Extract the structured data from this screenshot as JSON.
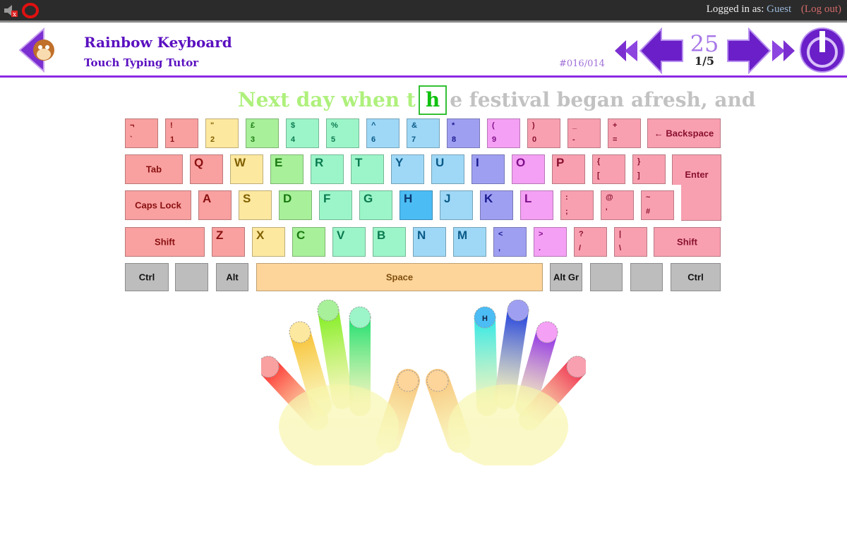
{
  "topbar": {
    "logged_in_label": "Logged in as:",
    "user": "Guest",
    "logout": "(Log out)",
    "icons": [
      "speaker-muted-icon",
      "lips-icon"
    ]
  },
  "header": {
    "title": "Rainbow Keyboard",
    "subtitle": "Touch Typing Tutor",
    "exercise_code": "#016/014",
    "lesson_number": "25",
    "page": "1/5",
    "icons": [
      "back-mascot-icon",
      "first-icon",
      "prev-icon",
      "next-icon",
      "last-icon",
      "power-icon"
    ]
  },
  "sentence": {
    "typed": "Next day when t",
    "current": "h",
    "remaining": "e festival began afresh, and"
  },
  "colors": {
    "pinkyL": "#f9a0a0",
    "ringL": "#fde8a0",
    "middleL": "#a8f09a",
    "indexL": "#9cf5c8",
    "indexR": "#9ed8f6",
    "active": "#4cbcf4",
    "middleR": "#9f9ff2",
    "ringR": "#f4a0f4",
    "pinkyR": "#f8a0b0",
    "thumb": "#fdd49a",
    "mod": "#bdbdbd"
  },
  "keyboard": {
    "rows": [
      [
        {
          "up": "¬",
          "lo": "`",
          "f": "pinkyL"
        },
        {
          "up": "!",
          "lo": "1",
          "f": "pinkyL"
        },
        {
          "up": "\"",
          "lo": "2",
          "f": "ringL"
        },
        {
          "up": "£",
          "lo": "3",
          "f": "middleL"
        },
        {
          "up": "$",
          "lo": "4",
          "f": "indexL"
        },
        {
          "up": "%",
          "lo": "5",
          "f": "indexL"
        },
        {
          "up": "^",
          "lo": "6",
          "f": "indexR"
        },
        {
          "up": "&",
          "lo": "7",
          "f": "indexR"
        },
        {
          "up": "*",
          "lo": "8",
          "f": "middleR"
        },
        {
          "up": "(",
          "lo": "9",
          "f": "ringR"
        },
        {
          "up": ")",
          "lo": "0",
          "f": "pinkyR"
        },
        {
          "up": "_",
          "lo": "-",
          "f": "pinkyR"
        },
        {
          "up": "+",
          "lo": "=",
          "f": "pinkyR"
        },
        {
          "c": "← Backspace",
          "f": "pinkyR"
        }
      ],
      [
        {
          "c": "Tab",
          "f": "pinkyL"
        },
        {
          "b": "Q",
          "f": "pinkyL"
        },
        {
          "b": "W",
          "f": "ringL"
        },
        {
          "b": "E",
          "f": "middleL"
        },
        {
          "b": "R",
          "f": "indexL"
        },
        {
          "b": "T",
          "f": "indexL"
        },
        {
          "b": "Y",
          "f": "indexR"
        },
        {
          "b": "U",
          "f": "indexR"
        },
        {
          "b": "I",
          "f": "middleR"
        },
        {
          "b": "O",
          "f": "ringR"
        },
        {
          "b": "P",
          "f": "pinkyR"
        },
        {
          "up": "{",
          "lo": "[",
          "f": "pinkyR"
        },
        {
          "up": "}",
          "lo": "]",
          "f": "pinkyR"
        },
        {
          "c": "Enter",
          "f": "pinkyR"
        }
      ],
      [
        {
          "c": "Caps Lock",
          "f": "pinkyL"
        },
        {
          "b": "A",
          "f": "pinkyL"
        },
        {
          "b": "S",
          "f": "ringL"
        },
        {
          "b": "D",
          "f": "middleL"
        },
        {
          "b": "F",
          "f": "indexL"
        },
        {
          "b": "G",
          "f": "indexL"
        },
        {
          "b": "H",
          "f": "active"
        },
        {
          "b": "J",
          "f": "indexR"
        },
        {
          "b": "K",
          "f": "middleR"
        },
        {
          "b": "L",
          "f": "ringR"
        },
        {
          "up": ":",
          "lo": ";",
          "f": "pinkyR"
        },
        {
          "up": "@",
          "lo": "'",
          "f": "pinkyR"
        },
        {
          "up": "~",
          "lo": "#",
          "f": "pinkyR"
        }
      ],
      [
        {
          "c": "Shift",
          "f": "pinkyL"
        },
        {
          "b": "Z",
          "f": "pinkyL"
        },
        {
          "b": "X",
          "f": "ringL"
        },
        {
          "b": "C",
          "f": "middleL"
        },
        {
          "b": "V",
          "f": "indexL"
        },
        {
          "b": "B",
          "f": "indexL"
        },
        {
          "b": "N",
          "f": "indexR"
        },
        {
          "b": "M",
          "f": "indexR"
        },
        {
          "up": "<",
          "lo": ",",
          "f": "middleR"
        },
        {
          "up": ">",
          "lo": ".",
          "f": "ringR"
        },
        {
          "up": "?",
          "lo": "/",
          "f": "pinkyR"
        },
        {
          "up": "|",
          "lo": "\\",
          "f": "pinkyR"
        },
        {
          "c": "Shift",
          "f": "pinkyR"
        }
      ],
      [
        {
          "c": "Ctrl",
          "f": "mod"
        },
        {
          "c": "",
          "f": "mod"
        },
        {
          "c": "Alt",
          "f": "mod"
        },
        {
          "c": "Space",
          "f": "thumb"
        },
        {
          "c": "Alt Gr",
          "f": "mod"
        },
        {
          "c": "",
          "f": "mod"
        },
        {
          "c": "",
          "f": "mod"
        },
        {
          "c": "Ctrl",
          "f": "mod"
        }
      ]
    ]
  },
  "hands": {
    "active_finger_label": "H"
  }
}
